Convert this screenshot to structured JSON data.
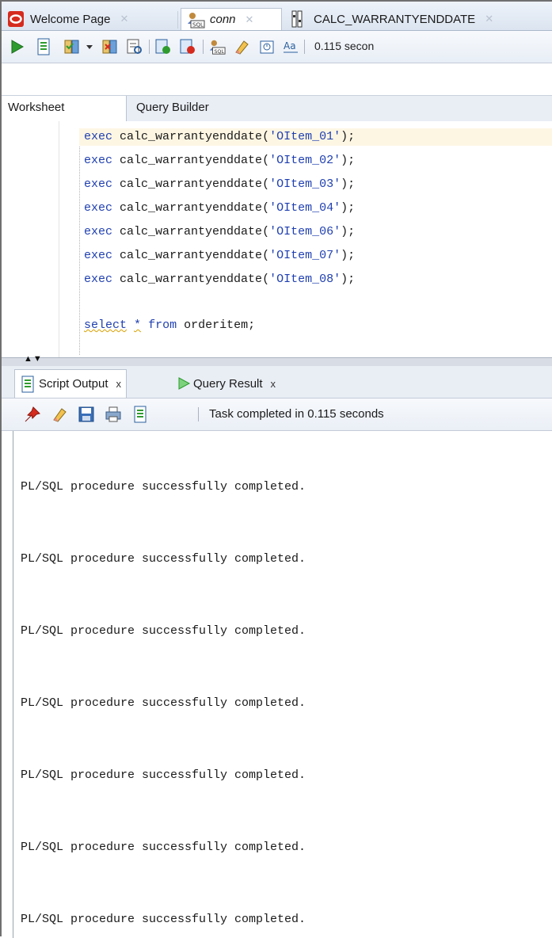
{
  "doc_tabs": [
    {
      "label": "Welcome Page",
      "icon": "oracle-icon",
      "active": false
    },
    {
      "label": "conn",
      "icon": "sql-connection-icon",
      "active": true
    },
    {
      "label": "CALC_WARRANTYENDDATE",
      "icon": "procedure-icon",
      "active": false
    }
  ],
  "toolbar": {
    "icons": [
      "run-statement-icon",
      "run-script-icon",
      "commit-icon",
      "dropdown-icon",
      "rollback-icon",
      "explain-plan-icon",
      "autotrace-icon",
      "sql-tuning-icon",
      "sql-history-icon",
      "clear-icon",
      "format-icon",
      "to-case-icon"
    ],
    "timing": "0.115 secon"
  },
  "worksheet_tabs": [
    "Worksheet",
    "Query Builder"
  ],
  "code": {
    "procedure_lines": [
      {
        "kw": "exec",
        "fn": "calc_warrantyenddate",
        "arg": "'OItem_01'"
      },
      {
        "kw": "exec",
        "fn": "calc_warrantyenddate",
        "arg": "'OItem_02'"
      },
      {
        "kw": "exec",
        "fn": "calc_warrantyenddate",
        "arg": "'OItem_03'"
      },
      {
        "kw": "exec",
        "fn": "calc_warrantyenddate",
        "arg": "'OItem_04'"
      },
      {
        "kw": "exec",
        "fn": "calc_warrantyenddate",
        "arg": "'OItem_06'"
      },
      {
        "kw": "exec",
        "fn": "calc_warrantyenddate",
        "arg": "'OItem_07'"
      },
      {
        "kw": "exec",
        "fn": "calc_warrantyenddate",
        "arg": "'OItem_08'"
      }
    ],
    "select_line": {
      "select": "select",
      "star": "*",
      "from": "from",
      "table": "orderitem;"
    }
  },
  "output_tabs": [
    {
      "label": "Script Output",
      "close": "x"
    },
    {
      "label": "Query Result",
      "close": "x"
    }
  ],
  "output_toolbar": {
    "status": "Task completed in 0.115 seconds"
  },
  "output_lines": [
    "PL/SQL procedure successfully completed.",
    "PL/SQL procedure successfully completed.",
    "PL/SQL procedure successfully completed.",
    "PL/SQL procedure successfully completed.",
    "PL/SQL procedure successfully completed.",
    "PL/SQL procedure successfully completed.",
    "PL/SQL procedure successfully completed."
  ],
  "colors": {
    "keyword": "#1f3fb0",
    "current_line": "#fdf6e3",
    "oracle_red": "#d52b1e",
    "run_green": "#2e9b2e"
  }
}
